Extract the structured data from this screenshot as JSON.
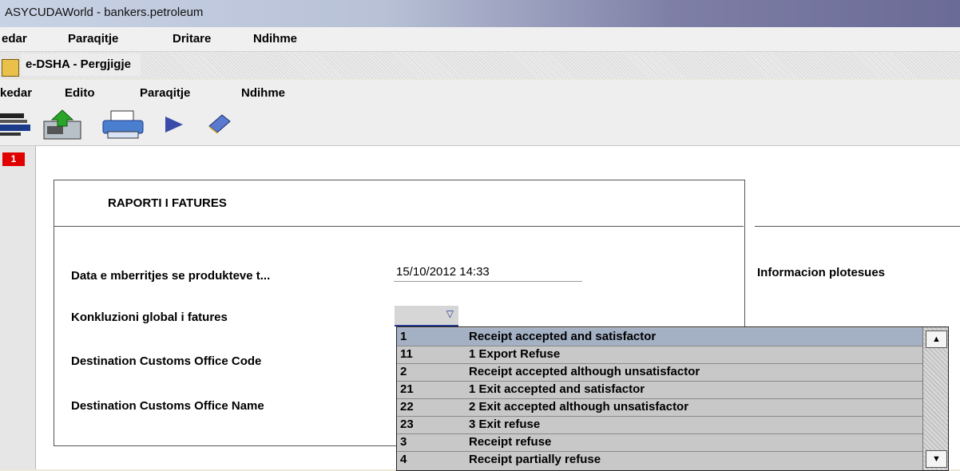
{
  "app_title": "ASYCUDAWorld - bankers.petroleum",
  "main_menu": [
    "edar",
    "Paraqitje",
    "Dritare",
    "Ndihme"
  ],
  "window_title": "e-DSHA - Pergjigje",
  "window_menu": [
    "kedar",
    "Edito",
    "Paraqitje",
    "Ndihme"
  ],
  "page_badge": "1",
  "form": {
    "section_title": "RAPORTI I FATURES",
    "fields": [
      {
        "label": "Data e mberritjes se produkteve t..."
      },
      {
        "label": "Konkluzioni global i fatures"
      },
      {
        "label": "Destination Customs Office Code"
      },
      {
        "label": "Destination Customs Office Name"
      }
    ],
    "date_value": "15/10/2012 14:33",
    "side_label": "Informacion plotesues"
  },
  "dropdown": {
    "selected_index": 0,
    "options": [
      {
        "code": "1",
        "text": "Receipt accepted and satisfactor"
      },
      {
        "code": "11",
        "text": "1 Export Refuse"
      },
      {
        "code": "2",
        "text": "Receipt accepted although unsatisfactor"
      },
      {
        "code": "21",
        "text": "1 Exit accepted and satisfactor"
      },
      {
        "code": "22",
        "text": "2 Exit accepted although unsatisfactor"
      },
      {
        "code": "23",
        "text": "3 Exit refuse"
      },
      {
        "code": "3",
        "text": "Receipt refuse"
      },
      {
        "code": "4",
        "text": "Receipt partially refuse"
      }
    ]
  },
  "toolbar_icons": [
    "scanner-icon",
    "upload-icon",
    "print-icon",
    "play-icon",
    "book-icon"
  ]
}
